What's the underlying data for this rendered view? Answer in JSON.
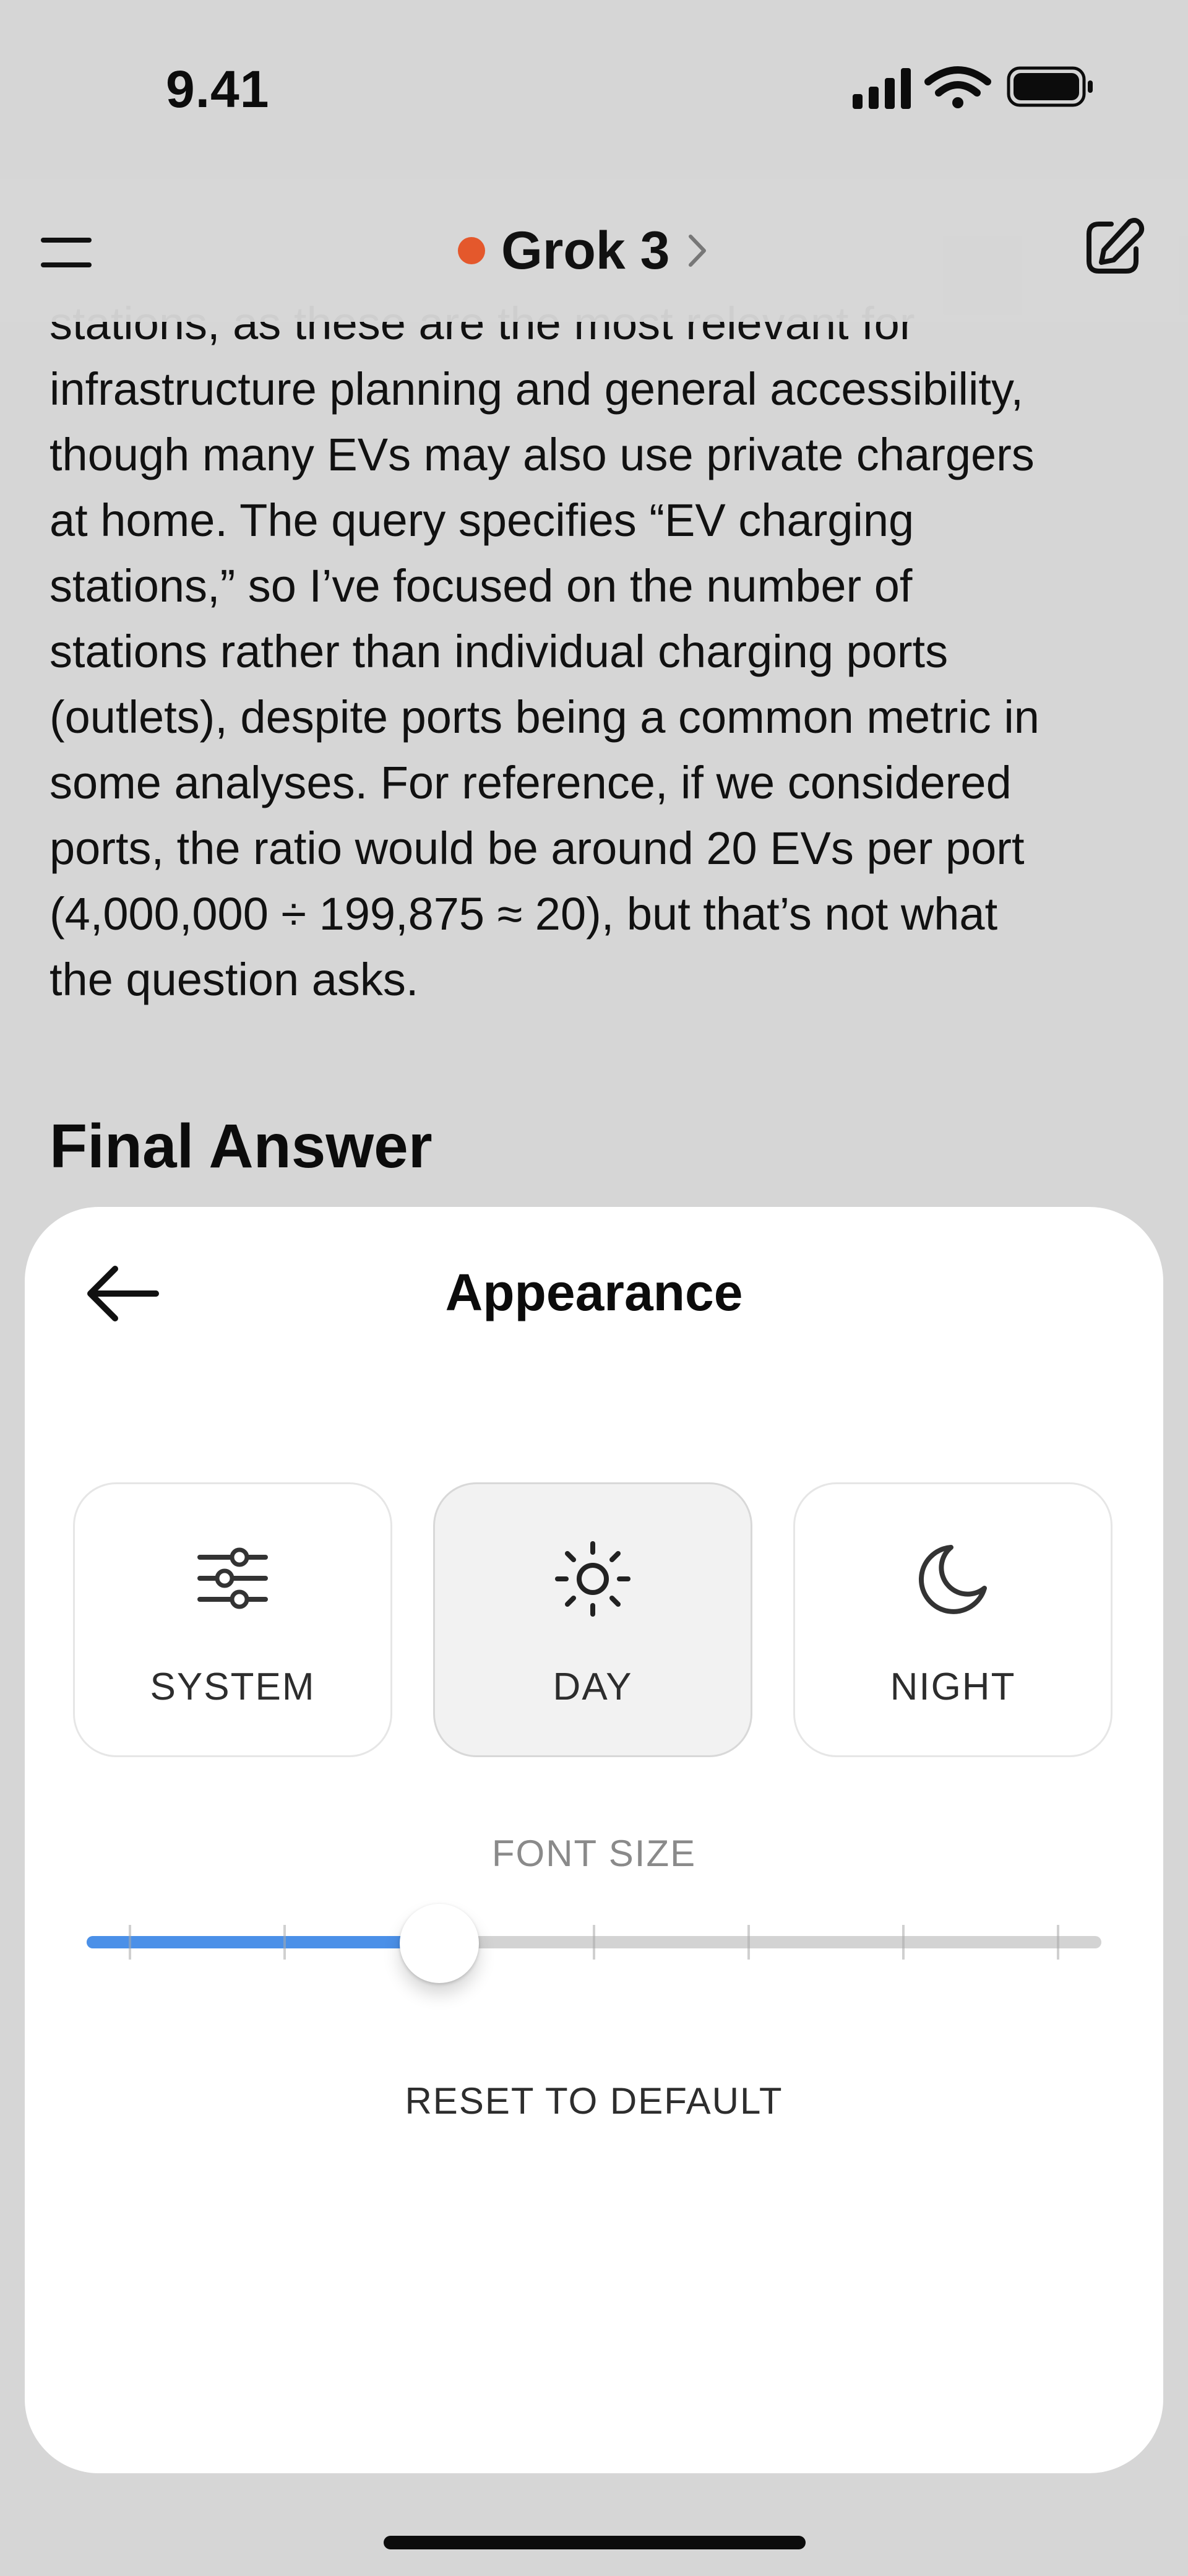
{
  "status_bar": {
    "time": "9.41",
    "icons": [
      "signal-icon",
      "wifi-icon",
      "battery-icon"
    ]
  },
  "header": {
    "menu_icon": "hamburger-menu-icon",
    "model_name": "Grok 3",
    "model_status_color": "#e4582c",
    "new_chat_icon": "compose-icon"
  },
  "chat": {
    "paragraph": "stations, as these are the most relevant for\ninfrastructure planning and general accessibility,\nthough many EVs may also use private chargers\nat home. The query specifies “EV charging\nstations,” so I’ve focused on the number of\nstations rather than individual charging ports\n(outlets), despite ports being a common metric in\nsome analyses. For reference, if we considered\nports, the ratio would be around 20 EVs per port\n(4,000,000 ÷ 199,875 ≈ 20), but that’s not what\nthe question asks.",
    "final_heading": "Final Answer"
  },
  "appearance_sheet": {
    "title": "Appearance",
    "back_icon": "arrow-left-icon",
    "themes": [
      {
        "label": "SYSTEM",
        "icon": "sliders-icon",
        "selected": false
      },
      {
        "label": "DAY",
        "icon": "sun-icon",
        "selected": true
      },
      {
        "label": "NIGHT",
        "icon": "moon-icon",
        "selected": false
      }
    ],
    "font_size_label": "FONT SIZE",
    "font_size": {
      "steps": 7,
      "selected_step": 3,
      "accent_color": "#4b90e8"
    },
    "reset_label": "RESET TO DEFAULT"
  }
}
